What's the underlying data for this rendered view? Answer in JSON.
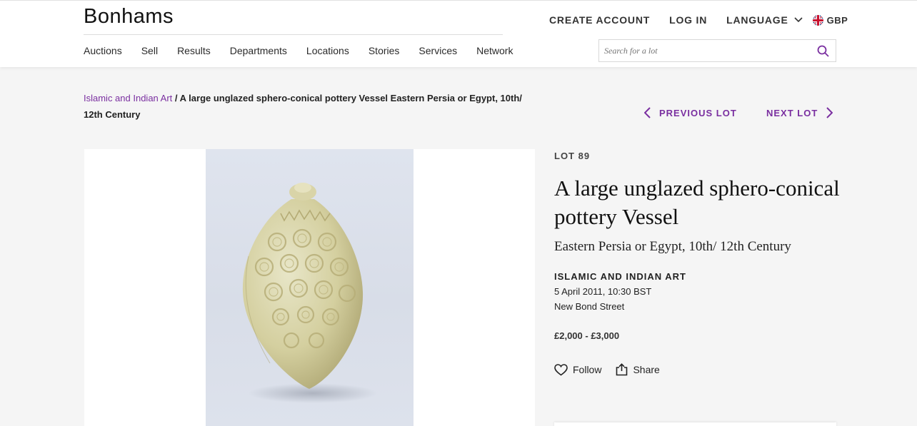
{
  "header": {
    "logo": "Bonhams",
    "top_links": {
      "create_account": "CREATE ACCOUNT",
      "log_in": "LOG IN",
      "language": "LANGUAGE",
      "currency": "GBP"
    },
    "nav": [
      "Auctions",
      "Sell",
      "Results",
      "Departments",
      "Locations",
      "Stories",
      "Services",
      "Network"
    ],
    "search": {
      "placeholder": "Search for a lot",
      "value": ""
    }
  },
  "breadcrumb": {
    "parent": "Islamic and Indian Art",
    "separator": " / ",
    "current": "A large unglazed sphero-conical pottery Vessel Eastern Persia or Egypt, 10th/ 12th Century"
  },
  "lot_nav": {
    "previous": "PREVIOUS LOT",
    "next": "NEXT LOT"
  },
  "lot": {
    "number": "LOT 89",
    "title": "A large unglazed sphero-conical pottery Vessel",
    "subtitle": "Eastern Persia or Egypt, 10th/ 12th Century",
    "department": "ISLAMIC AND INDIAN ART",
    "date": "5 April 2011, 10:30 BST",
    "venue": "New Bond Street",
    "estimate": "£2,000 - £3,000"
  },
  "actions": {
    "follow": "Follow",
    "share": "Share"
  },
  "colors": {
    "accent": "#7a2fa0",
    "background": "#f5f5f5"
  }
}
